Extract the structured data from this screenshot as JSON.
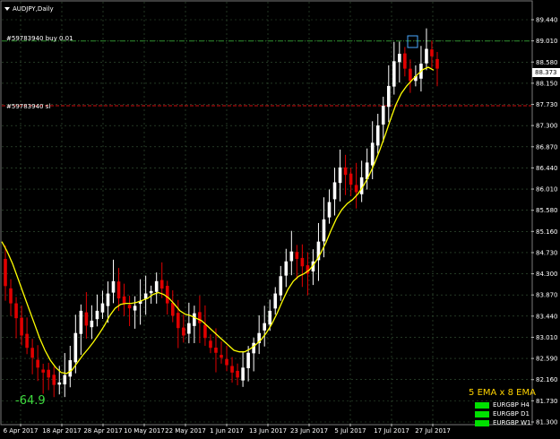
{
  "title": {
    "symbol_timeframe": "AUDJPY,Daily"
  },
  "colors": {
    "background": "#000000",
    "grid": "#3a5a3a",
    "bull": "#ffffff",
    "bear": "#e00000",
    "ema": "#ffff00",
    "buy_line": "#2f8f2f",
    "sl_line": "#d01010",
    "indicator": "#3fdc3f",
    "panel_title": "#ffd300",
    "panel_box": "#00e000"
  },
  "price_axis": {
    "labels": [
      "89.440",
      "89.010",
      "88.580",
      "88.150",
      "87.730",
      "87.300",
      "86.870",
      "86.440",
      "86.010",
      "85.580",
      "85.160",
      "84.730",
      "84.300",
      "83.870",
      "83.440",
      "83.010",
      "82.590",
      "82.160",
      "81.730",
      "81.300"
    ],
    "min": 81.3,
    "max": 89.44,
    "current_price": "88.373"
  },
  "time_axis": {
    "labels": [
      "6 Apr 2017",
      "18 Apr 2017",
      "28 Apr 2017",
      "10 May 2017",
      "22 May 2017",
      "1 Jun 2017",
      "13 Jun 2017",
      "23 Jun 2017",
      "5 Jul 2017",
      "17 Jul 2017",
      "27 Jul 2017"
    ]
  },
  "order_lines": [
    {
      "label": "#59783940 buy 0.01",
      "price": 89.01,
      "style": "dash-dot",
      "color": "#2f8f2f"
    },
    {
      "label": "#59783940 sl",
      "price": 87.7,
      "style": "dash",
      "color": "#d01010"
    }
  ],
  "indicator_value": "-64.9",
  "panel": {
    "title": "5 EMA x 8 EMA",
    "rows": [
      {
        "label": "EURGBP H4",
        "color": "#00e000"
      },
      {
        "label": "EURGBP D1",
        "color": "#00e000"
      },
      {
        "label": "EURGBP W1",
        "color": "#00e000"
      }
    ]
  },
  "chart_data": {
    "type": "candlestick",
    "symbol": "AUDJPY",
    "timeframe": "Daily",
    "ylim": [
      81.3,
      89.44
    ],
    "x_tick_labels": [
      "6 Apr 2017",
      "18 Apr 2017",
      "28 Apr 2017",
      "10 May 2017",
      "22 May 2017",
      "1 Jun 2017",
      "13 Jun 2017",
      "23 Jun 2017",
      "5 Jul 2017",
      "17 Jul 2017",
      "27 Jul 2017"
    ],
    "closes": [
      84.05,
      83.7,
      83.4,
      83.05,
      82.8,
      82.6,
      82.4,
      82.3,
      82.2,
      82.05,
      82.1,
      82.25,
      82.55,
      83.1,
      83.55,
      83.25,
      83.35,
      83.55,
      83.7,
      83.9,
      84.15,
      83.8,
      83.7,
      83.6,
      83.65,
      83.75,
      83.9,
      83.95,
      84.15,
      84.0,
      83.7,
      83.45,
      83.2,
      83.05,
      83.3,
      83.5,
      83.3,
      83.0,
      82.8,
      82.7,
      82.6,
      82.45,
      82.3,
      82.2,
      82.4,
      82.7,
      82.9,
      83.1,
      83.3,
      83.55,
      83.9,
      84.25,
      84.55,
      84.75,
      84.6,
      84.45,
      84.3,
      84.55,
      84.95,
      85.4,
      85.75,
      86.15,
      86.45,
      86.3,
      86.1,
      85.95,
      86.25,
      86.55,
      86.95,
      87.3,
      87.7,
      88.1,
      88.6,
      88.75,
      88.45,
      88.2,
      88.3,
      88.55,
      88.85,
      88.7,
      88.45
    ],
    "ema": [
      84.95,
      84.75,
      84.5,
      84.2,
      83.9,
      83.6,
      83.3,
      83.0,
      82.75,
      82.55,
      82.4,
      82.3,
      82.28,
      82.35,
      82.5,
      82.65,
      82.78,
      82.92,
      83.08,
      83.25,
      83.45,
      83.6,
      83.68,
      83.7,
      83.7,
      83.72,
      83.76,
      83.8,
      83.88,
      83.92,
      83.88,
      83.8,
      83.68,
      83.55,
      83.48,
      83.45,
      83.4,
      83.35,
      83.25,
      83.15,
      83.05,
      82.95,
      82.85,
      82.75,
      82.72,
      82.72,
      82.78,
      82.86,
      82.96,
      83.1,
      83.28,
      83.5,
      83.75,
      83.98,
      84.15,
      84.25,
      84.3,
      84.38,
      84.52,
      84.7,
      84.92,
      85.18,
      85.42,
      85.6,
      85.72,
      85.8,
      85.92,
      86.08,
      86.28,
      86.52,
      86.8,
      87.1,
      87.42,
      87.72,
      87.95,
      88.1,
      88.22,
      88.33,
      88.43,
      88.48,
      88.42
    ]
  }
}
